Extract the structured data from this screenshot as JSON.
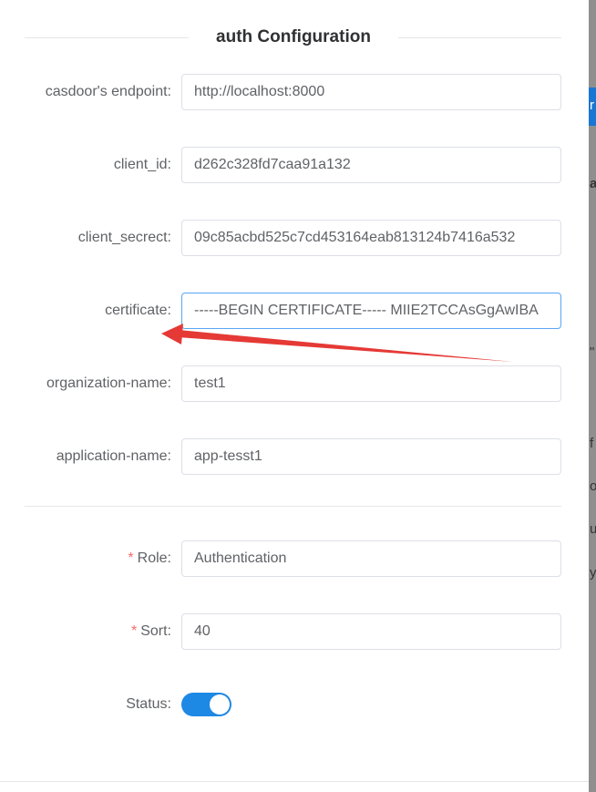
{
  "section": {
    "title": "auth Configuration"
  },
  "fields": [
    {
      "label": "casdoor's endpoint",
      "value": "http://localhost:8000",
      "required": false
    },
    {
      "label": "client_id",
      "value": "d262c328fd7caa91a132",
      "required": false
    },
    {
      "label": "client_secrect",
      "value": "09c85acbd525c7cd453164eab813124b7416a532",
      "required": false
    },
    {
      "label": "certificate",
      "value": "-----BEGIN CERTIFICATE----- MIIE2TCCAsGgAwIBA",
      "required": false
    },
    {
      "label": "organization-name",
      "value": "test1",
      "required": false
    },
    {
      "label": "application-name",
      "value": "app-tesst1",
      "required": false
    }
  ],
  "settings": {
    "role": {
      "label": "Role",
      "value": "Authentication",
      "required": true
    },
    "sort": {
      "label": "Sort",
      "value": "40",
      "required": true
    },
    "status": {
      "label": "Status",
      "enabled": true
    }
  },
  "colon": ":",
  "required_mark": "*",
  "background_peek": [
    "r",
    "a",
    "\"",
    "f",
    "o",
    "u",
    "y"
  ],
  "colors": {
    "accent": "#1e88e5",
    "annotation_arrow": "#e53935",
    "required": "#f56c6c"
  }
}
